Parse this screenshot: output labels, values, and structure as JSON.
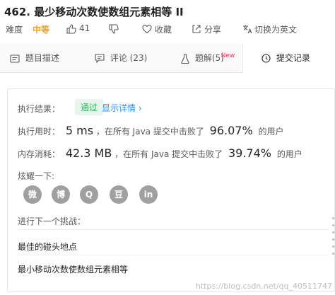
{
  "problem": {
    "title": "462. 最少移动次数使数组元素相等 II",
    "difficulty_label": "难度",
    "difficulty_value": "中等",
    "likes": "41",
    "favorite_label": "收藏",
    "share_label": "分享",
    "translate_label": "切换为英文"
  },
  "tabs": [
    {
      "label": "题目描述"
    },
    {
      "label": "评论 (23)"
    },
    {
      "label": "题解(5)",
      "badge": "New"
    },
    {
      "label": "提交记录"
    }
  ],
  "result": {
    "label": "执行结果：",
    "status": "通过",
    "details_link": "显示详情 ›",
    "runtime_label": "执行用时：",
    "runtime_value": "5 ms",
    "runtime_mid": "，在所有 Java 提交中击败了",
    "runtime_pct": "96.07%",
    "runtime_suffix": "的用户",
    "memory_label": "内存消耗：",
    "memory_value": "42.3 MB",
    "memory_mid": "，在所有 Java 提交中击败了",
    "memory_pct": "39.74%",
    "memory_suffix": "的用户",
    "share_prompt": "炫耀一下:",
    "share_icons": [
      "wechat-icon",
      "weibo-icon",
      "qq-icon",
      "douban-icon",
      "linkedin-icon"
    ],
    "share_glyphs": [
      "微",
      "博",
      "Q",
      "豆",
      "in"
    ],
    "next_label": "进行下一个挑战：",
    "next_items": [
      "最佳的碰头地点",
      "最小移动次数使数组元素相等"
    ]
  },
  "watermark": "https://blog.csdn.net/qq_40511747",
  "colors": {
    "accent": "#1a90ff",
    "pass_green": "#2db55d",
    "medium": "#f0a020"
  }
}
